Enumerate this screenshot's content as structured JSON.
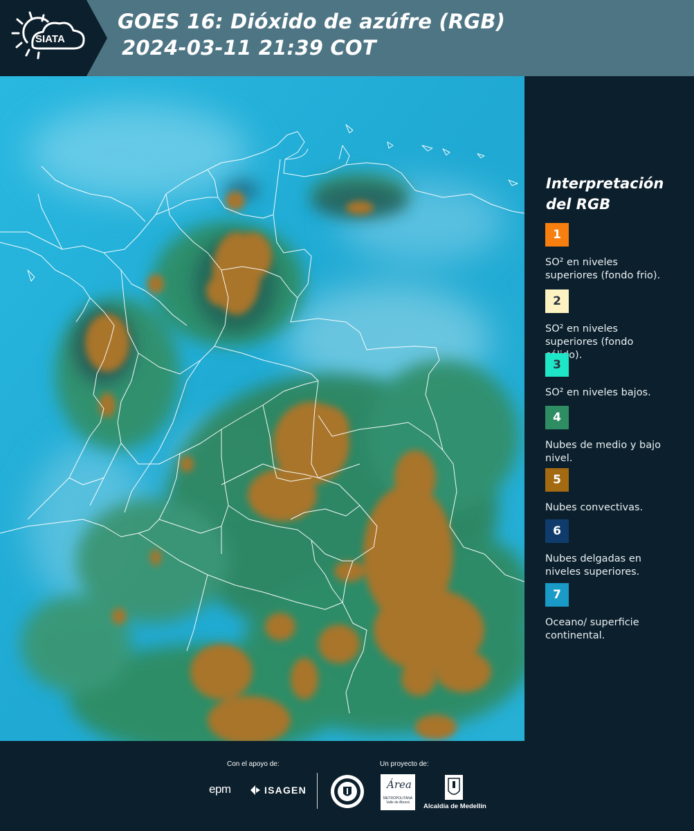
{
  "header": {
    "logo_text": "SIATA",
    "title_line1": "GOES 16: Dióxido de azúfre (RGB)",
    "title_line2": "2024-03-11 21:39 COT"
  },
  "map": {
    "icon": "satellite-map-image"
  },
  "legend": {
    "title": "Interpretación del RGB",
    "items": [
      {
        "num": "1",
        "color": "#f77f0f",
        "text": "SO² en niveles superiores (fondo frio)."
      },
      {
        "num": "2",
        "color": "#fdf3c2",
        "text": "SO² en niveles superiores (fondo cálido)."
      },
      {
        "num": "3",
        "color": "#1de7c6",
        "text": "SO² en niveles bajos."
      },
      {
        "num": "4",
        "color": "#2f8d64",
        "text": "Nubes de medio y bajo nivel."
      },
      {
        "num": "5",
        "color": "#a36a12",
        "text": "Nubes convectivas."
      },
      {
        "num": "6",
        "color": "#0f3c6c",
        "text": "Nubes delgadas en niveles superiores."
      },
      {
        "num": "7",
        "color": "#1a9ac7",
        "text": "Oceano/ superficie continental."
      }
    ]
  },
  "footer": {
    "support_label": "Con el apoyo de:",
    "project_label": "Un proyecto de:",
    "sponsors": [
      "epm",
      "ISAGEN"
    ],
    "metro_name": "Área",
    "metro_subtitle": "METROPOLITANA Valle de Aburrá",
    "alcaldia": "Alcaldía de Medellín"
  }
}
